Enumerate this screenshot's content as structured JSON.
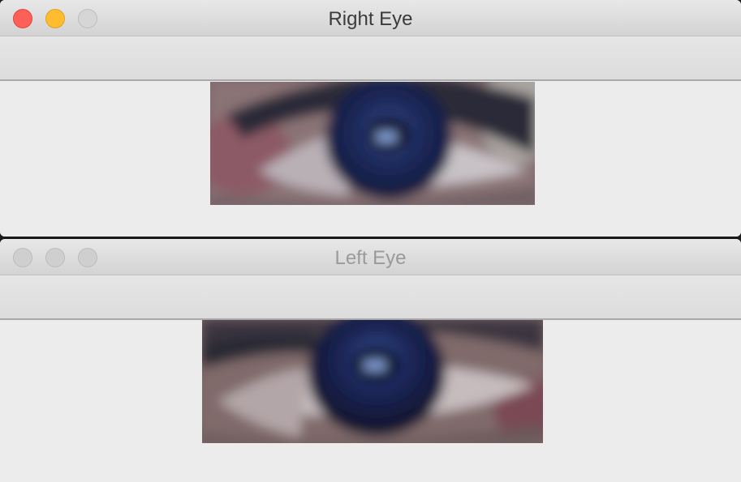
{
  "windows": {
    "right": {
      "title": "Right Eye",
      "image": "right-eye-closeup"
    },
    "left": {
      "title": "Left Eye",
      "image": "left-eye-closeup"
    }
  },
  "icons": {
    "close": "close-icon",
    "minimize": "minimize-icon",
    "zoom": "zoom-icon"
  },
  "colors": {
    "close": "#fe5f57",
    "minimize": "#febc2e",
    "zoom_inactive": "#d6d6d6",
    "window_background": "#ececec"
  }
}
